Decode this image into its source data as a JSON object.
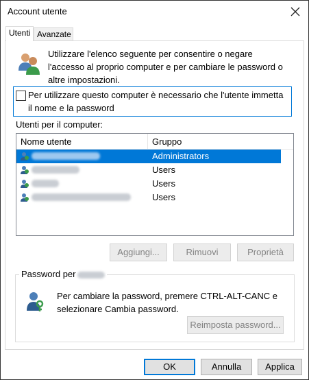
{
  "window": {
    "title": "Account utente"
  },
  "tabs": [
    {
      "label": "Utenti",
      "active": true
    },
    {
      "label": "Avanzate",
      "active": false
    }
  ],
  "intro_text": "Utilizzare l'elenco seguente per consentire o negare l'accesso al proprio computer e per cambiare le password o altre impostazioni.",
  "require_login": {
    "label": "Per utilizzare questo computer è necessario che l'utente immetta il nome e la password",
    "checked": false
  },
  "users": {
    "section_label": "Utenti per il computer:",
    "columns": [
      "Nome utente",
      "Gruppo"
    ],
    "rows": [
      {
        "group": "Administrators",
        "selected": true
      },
      {
        "group": "Users",
        "selected": false
      },
      {
        "group": "Users",
        "selected": false
      },
      {
        "group": "Users",
        "selected": false
      }
    ]
  },
  "buttons": {
    "add": "Aggiungi...",
    "remove": "Rimuovi",
    "properties": "Proprietà",
    "reset_password": "Reimposta password...",
    "ok": "OK",
    "cancel": "Annulla",
    "apply": "Applica"
  },
  "password_group": {
    "title": "Password per",
    "text": "Per cambiare la password, premere CTRL-ALT-CANC e selezionare Cambia password."
  },
  "colors": {
    "selection": "#0078d7",
    "disabled_text": "#838383"
  },
  "icons": [
    "close-icon",
    "users-icon",
    "user-icon",
    "key-user-icon"
  ]
}
